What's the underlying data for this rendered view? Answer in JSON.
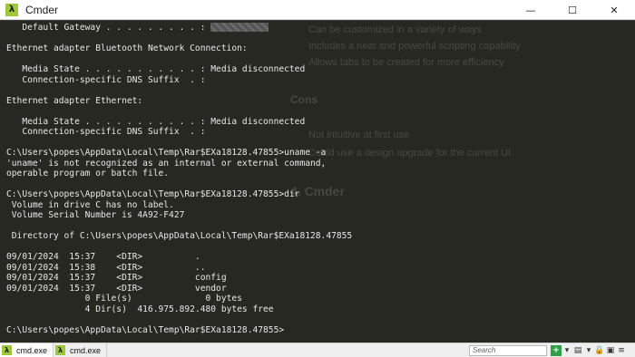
{
  "window": {
    "title": "Cmder",
    "app_icon": "λ",
    "controls": {
      "minimize": "—",
      "maximize": "☐",
      "close": "✕"
    }
  },
  "terminal": {
    "lines": [
      "   Default Gateway . . . . . . . . . : ",
      "",
      "Ethernet adapter Bluetooth Network Connection:",
      "",
      "   Media State . . . . . . . . . . . : Media disconnected",
      "   Connection-specific DNS Suffix  . :",
      "",
      "Ethernet adapter Ethernet:",
      "",
      "   Media State . . . . . . . . . . . : Media disconnected",
      "   Connection-specific DNS Suffix  . :",
      "",
      "C:\\Users\\popes\\AppData\\Local\\Temp\\Rar$EXa18128.47855>uname -a",
      "'uname' is not recognized as an internal or external command,",
      "operable program or batch file.",
      "",
      "C:\\Users\\popes\\AppData\\Local\\Temp\\Rar$EXa18128.47855>dir",
      " Volume in drive C has no label.",
      " Volume Serial Number is 4A92-F427",
      "",
      " Directory of C:\\Users\\popes\\AppData\\Local\\Temp\\Rar$EXa18128.47855",
      "",
      "09/01/2024  15:37    <DIR>          .",
      "09/01/2024  15:38    <DIR>          ..",
      "09/01/2024  15:37    <DIR>          config",
      "09/01/2024  15:37    <DIR>          vendor",
      "               0 File(s)              0 bytes",
      "               4 Dir(s)  416.975.892.480 bytes free",
      "",
      "C:\\Users\\popes\\AppData\\Local\\Temp\\Rar$EXa18128.47855>"
    ]
  },
  "background_document": {
    "lines": [
      "Can be customized in a variety of ways",
      "Includes a neat and powerful scripting capability",
      "Allows tabs to be created for more efficiency"
    ],
    "cons_heading": "Cons",
    "cons_lines": [
      "Not intuitive at first use",
      "Could use a design upgrade for the current UI"
    ],
    "section_heading": "4. Cmder"
  },
  "tabs": [
    {
      "label": "cmd.exe",
      "active": true,
      "icon": "λ"
    },
    {
      "label": "cmd.exe",
      "active": false,
      "icon": ""
    }
  ],
  "search": {
    "placeholder": "Search"
  },
  "colors": {
    "console_bg": "#272822",
    "console_fg": "#e8e8e8",
    "accent_green": "#9ec73c"
  }
}
